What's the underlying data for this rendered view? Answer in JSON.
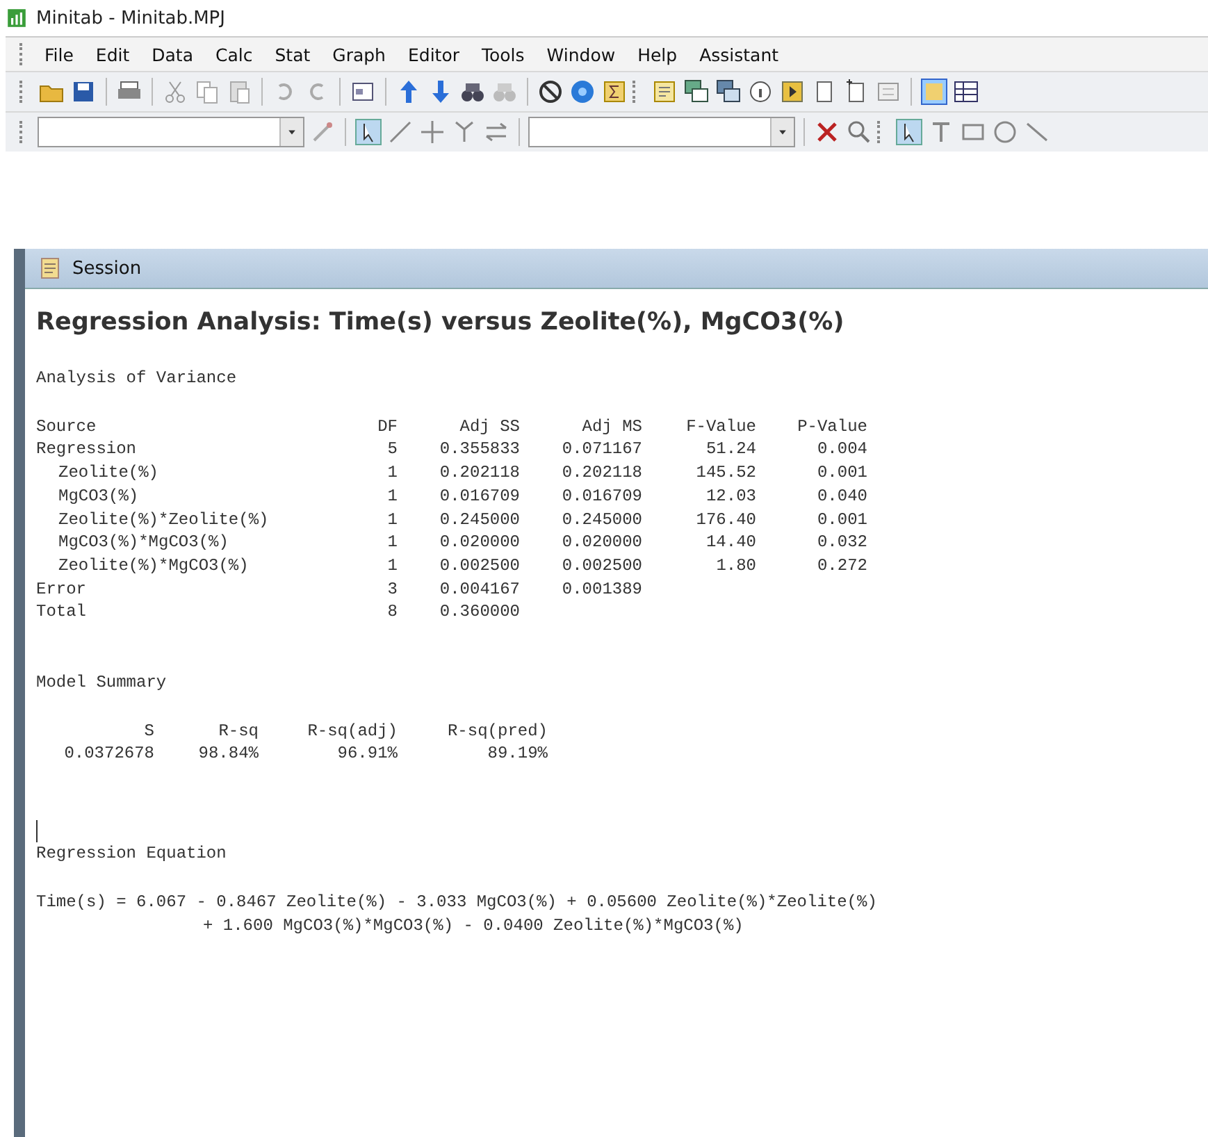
{
  "window": {
    "title": "Minitab - Minitab.MPJ"
  },
  "menu": [
    "File",
    "Edit",
    "Data",
    "Calc",
    "Stat",
    "Graph",
    "Editor",
    "Tools",
    "Window",
    "Help",
    "Assistant"
  ],
  "session": {
    "title": "Session",
    "heading": "Regression Analysis: Time(s) versus Zeolite(%), MgCO3(%)",
    "anova": {
      "title": "Analysis of Variance",
      "columns": [
        "Source",
        "DF",
        "Adj SS",
        "Adj MS",
        "F-Value",
        "P-Value"
      ],
      "rows": [
        {
          "cells": [
            "Regression",
            "5",
            "0.355833",
            "0.071167",
            "51.24",
            "0.004"
          ],
          "indented": false
        },
        {
          "cells": [
            "Zeolite(%)",
            "1",
            "0.202118",
            "0.202118",
            "145.52",
            "0.001"
          ],
          "indented": true
        },
        {
          "cells": [
            "MgCO3(%)",
            "1",
            "0.016709",
            "0.016709",
            "12.03",
            "0.040"
          ],
          "indented": true
        },
        {
          "cells": [
            "Zeolite(%)*Zeolite(%)",
            "1",
            "0.245000",
            "0.245000",
            "176.40",
            "0.001"
          ],
          "indented": true
        },
        {
          "cells": [
            "MgCO3(%)*MgCO3(%)",
            "1",
            "0.020000",
            "0.020000",
            "14.40",
            "0.032"
          ],
          "indented": true
        },
        {
          "cells": [
            "Zeolite(%)*MgCO3(%)",
            "1",
            "0.002500",
            "0.002500",
            "1.80",
            "0.272"
          ],
          "indented": true
        },
        {
          "cells": [
            "Error",
            "3",
            "0.004167",
            "0.001389"
          ],
          "indented": false
        },
        {
          "cells": [
            "Total",
            "8",
            "0.360000"
          ],
          "indented": false
        }
      ]
    },
    "summary": {
      "title": "Model Summary",
      "columns": [
        "S",
        "R-sq",
        "R-sq(adj)",
        "R-sq(pred)"
      ],
      "values": [
        "0.0372678",
        "98.84%",
        "96.91%",
        "89.19%"
      ]
    },
    "equation": {
      "title": "Regression Equation",
      "lines": [
        "Time(s) = 6.067 - 0.8467 Zeolite(%) - 3.033 MgCO3(%) + 0.05600 Zeolite(%)*Zeolite(%)",
        "+ 1.600 MgCO3(%)*MgCO3(%) - 0.0400 Zeolite(%)*MgCO3(%)"
      ]
    }
  }
}
